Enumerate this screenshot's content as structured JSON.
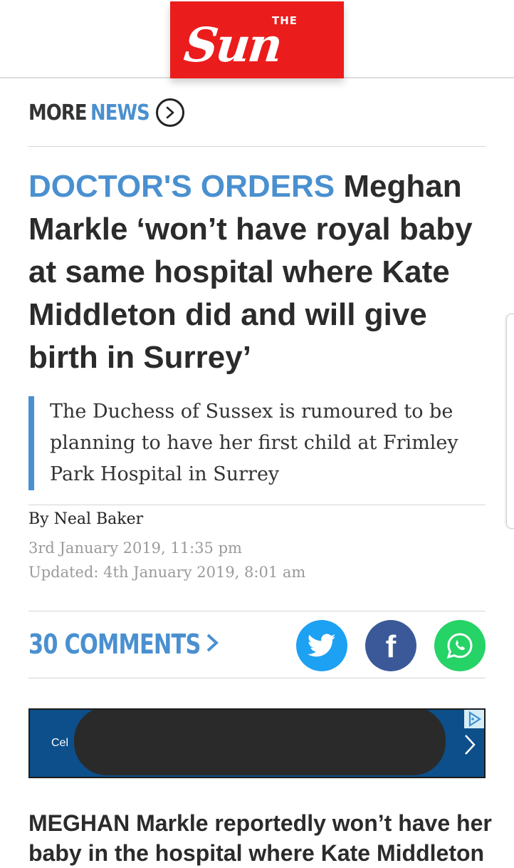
{
  "brand": {
    "logo_the": "THE",
    "logo_sun": "Sun",
    "color": "#eb1c1c"
  },
  "nav": {
    "more": "MORE",
    "news": "NEWS",
    "icon": "chevron-right-circle-icon"
  },
  "article": {
    "kicker": "DOCTOR'S ORDERS",
    "headline": "Meghan Markle ‘won’t have royal baby at same hospital where Kate Middleton did and will give birth in Surrey’",
    "standfirst": "The Duchess of Sussex is rumoured to be planning to have her first child at Frimley Park Hospital in Surrey",
    "byline": "By Neal Baker",
    "published": "3rd January 2019, 11:35 pm",
    "updated": "Updated: 4th January 2019, 8:01 am",
    "comments_label": "30 COMMENTS",
    "comments_chevron": ">",
    "body_lead": "MEGHAN Markle reportedly won’t have her baby in the hospital where Kate Middleton"
  },
  "share": {
    "twitter_icon": "twitter-icon",
    "facebook_icon": "facebook-icon",
    "whatsapp_icon": "whatsapp-icon",
    "facebook_glyph": "f"
  },
  "ad": {
    "text": "Cel",
    "chevron": "chevron-right-icon",
    "adchoices_icon": "adchoices-icon"
  },
  "colors": {
    "accent": "#4a90d0",
    "twitter": "#1da1f2",
    "facebook": "#3b5998",
    "whatsapp": "#25d366",
    "ad_bg": "#0d4f8b"
  }
}
